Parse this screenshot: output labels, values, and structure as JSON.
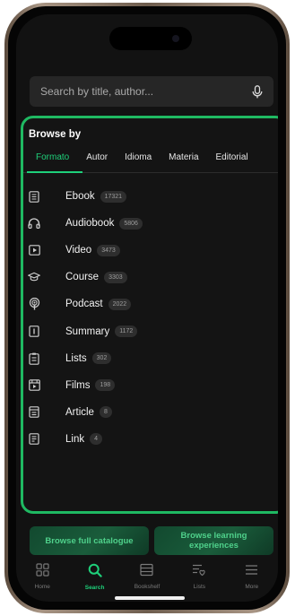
{
  "search": {
    "placeholder": "Search by title, author..."
  },
  "browse": {
    "title": "Browse by",
    "tabs": [
      {
        "label": "Formato"
      },
      {
        "label": "Autor"
      },
      {
        "label": "Idioma"
      },
      {
        "label": "Materia"
      },
      {
        "label": "Editorial"
      }
    ],
    "items": [
      {
        "label": "Ebook",
        "count": "17321",
        "icon": "book-icon"
      },
      {
        "label": "Audiobook",
        "count": "5806",
        "icon": "headphones-icon"
      },
      {
        "label": "Video",
        "count": "3473",
        "icon": "play-icon"
      },
      {
        "label": "Course",
        "count": "3303",
        "icon": "graduation-cap-icon"
      },
      {
        "label": "Podcast",
        "count": "2022",
        "icon": "podcast-icon"
      },
      {
        "label": "Summary",
        "count": "1172",
        "icon": "summary-icon"
      },
      {
        "label": "Lists",
        "count": "302",
        "icon": "clipboard-icon"
      },
      {
        "label": "Films",
        "count": "198",
        "icon": "film-icon"
      },
      {
        "label": "Article",
        "count": "8",
        "icon": "article-icon"
      },
      {
        "label": "Link",
        "count": "4",
        "icon": "link-icon"
      }
    ]
  },
  "cta": {
    "full_catalogue": "Browse full catalogue",
    "learning": "Browse learning experiences"
  },
  "nav": [
    {
      "label": "Home",
      "icon": "grid-icon"
    },
    {
      "label": "Search",
      "icon": "search-icon"
    },
    {
      "label": "Bookshelf",
      "icon": "bookshelf-icon"
    },
    {
      "label": "Lists",
      "icon": "list-heart-icon"
    },
    {
      "label": "More",
      "icon": "menu-icon"
    }
  ],
  "colors": {
    "accent": "#1ed07a",
    "frame": "#1fb962",
    "bg": "#121212"
  }
}
